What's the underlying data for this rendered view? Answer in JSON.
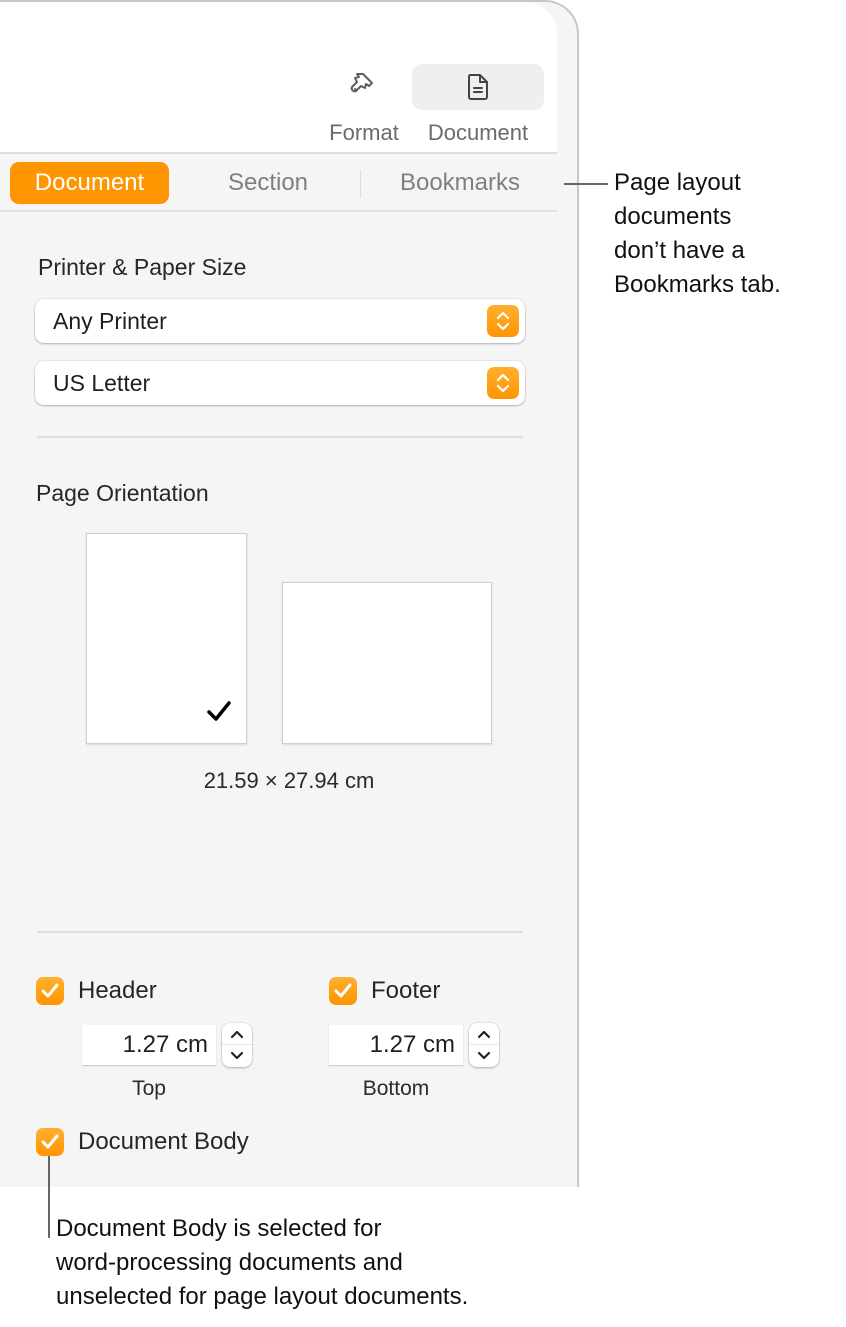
{
  "toolbar": {
    "buttons": [
      {
        "label": "Format",
        "icon": "paintbrush-icon",
        "active": false
      },
      {
        "label": "Document",
        "icon": "document-icon",
        "active": true
      }
    ]
  },
  "tabs": [
    {
      "label": "Document",
      "active": true
    },
    {
      "label": "Section",
      "active": false
    },
    {
      "label": "Bookmarks",
      "active": false
    }
  ],
  "printer_paper": {
    "heading": "Printer & Paper Size",
    "printer": {
      "value": "Any Printer"
    },
    "paper_size": {
      "value": "US Letter"
    }
  },
  "orientation": {
    "heading": "Page Orientation",
    "options": [
      {
        "name": "Portrait",
        "selected": true
      },
      {
        "name": "Landscape",
        "selected": false
      }
    ],
    "dimensions": "21.59 × 27.94 cm"
  },
  "header_footer": {
    "header": {
      "label": "Header",
      "checked": true,
      "value": "1.27 cm",
      "caption": "Top"
    },
    "footer": {
      "label": "Footer",
      "checked": true,
      "value": "1.27 cm",
      "caption": "Bottom"
    },
    "document_body": {
      "label": "Document Body",
      "checked": true
    }
  },
  "callouts": {
    "bookmarks_note": [
      "Page layout",
      "documents",
      "don’t have a",
      "Bookmarks tab."
    ],
    "body_note": [
      "Document Body is selected for",
      "word-processing documents and",
      "unselected for page layout documents."
    ]
  },
  "colors": {
    "accent": "#ff9500",
    "panel_bg": "#f5f5f5"
  }
}
